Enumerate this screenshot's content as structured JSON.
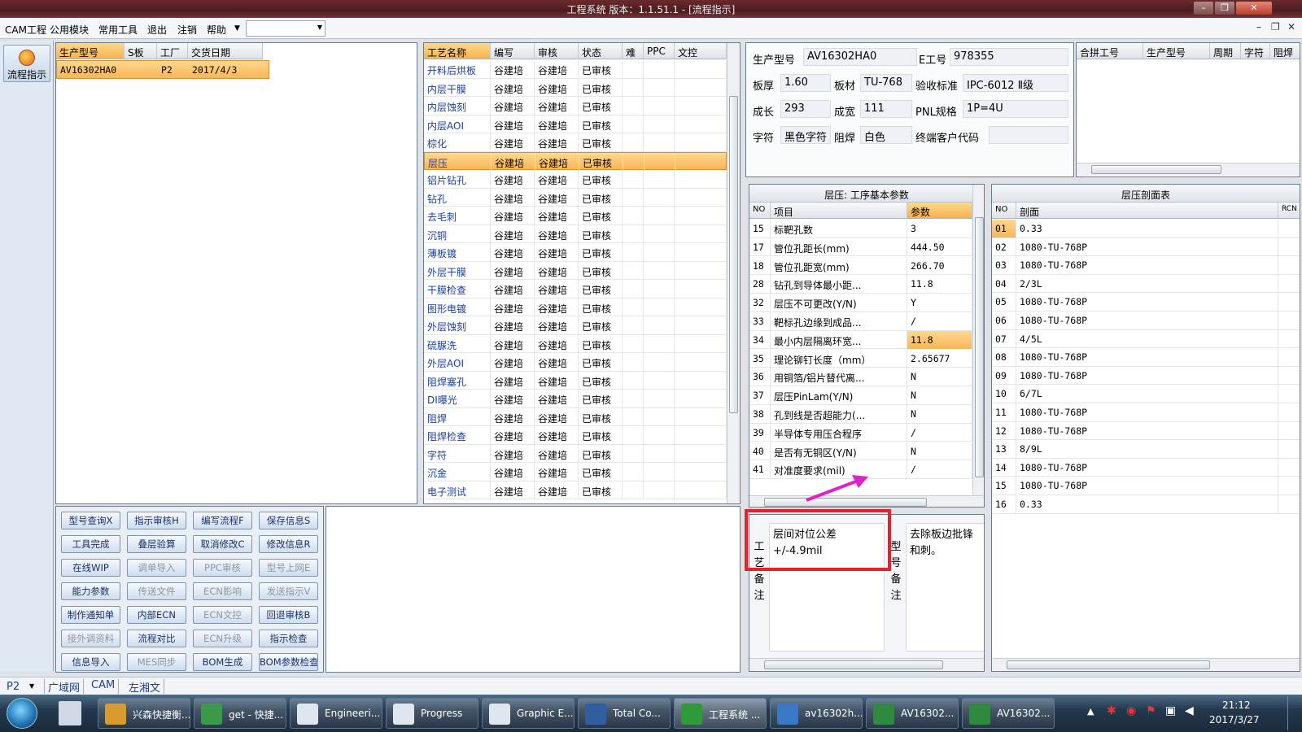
{
  "window": {
    "title": "工程系统  版本：1.1.51.1 - [流程指示]"
  },
  "menu": {
    "items": [
      "CAM工程",
      "公用模块",
      "常用工具",
      "退出",
      "注销",
      "帮助"
    ],
    "dropdown_value": ""
  },
  "left_toolbar": {
    "flow_button": "流程指示"
  },
  "order_grid": {
    "headers": [
      "生产型号",
      "S板",
      "工厂",
      "交货日期"
    ],
    "rows": [
      [
        "AV16302HA0",
        "",
        "P2",
        "2017/4/3"
      ]
    ]
  },
  "process_grid": {
    "headers": [
      "工艺名称",
      "编写",
      "审核",
      "状态",
      "难",
      "PPC",
      "文控"
    ],
    "rows": [
      [
        "开料后烘板",
        "谷建培",
        "谷建培",
        "已审核"
      ],
      [
        "内层干膜",
        "谷建培",
        "谷建培",
        "已审核"
      ],
      [
        "内层蚀刻",
        "谷建培",
        "谷建培",
        "已审核"
      ],
      [
        "内层AOI",
        "谷建培",
        "谷建培",
        "已审核"
      ],
      [
        "棕化",
        "谷建培",
        "谷建培",
        "已审核"
      ],
      [
        "层压",
        "谷建培",
        "谷建培",
        "已审核"
      ],
      [
        "铝片钻孔",
        "谷建培",
        "谷建培",
        "已审核"
      ],
      [
        "钻孔",
        "谷建培",
        "谷建培",
        "已审核"
      ],
      [
        "去毛刺",
        "谷建培",
        "谷建培",
        "已审核"
      ],
      [
        "沉铜",
        "谷建培",
        "谷建培",
        "已审核"
      ],
      [
        "薄板镀",
        "谷建培",
        "谷建培",
        "已审核"
      ],
      [
        "外层干膜",
        "谷建培",
        "谷建培",
        "已审核"
      ],
      [
        "干膜检查",
        "谷建培",
        "谷建培",
        "已审核"
      ],
      [
        "图形电镀",
        "谷建培",
        "谷建培",
        "已审核"
      ],
      [
        "外层蚀刻",
        "谷建培",
        "谷建培",
        "已审核"
      ],
      [
        "硫脲洗",
        "谷建培",
        "谷建培",
        "已审核"
      ],
      [
        "外层AOI",
        "谷建培",
        "谷建培",
        "已审核"
      ],
      [
        "阻焊塞孔",
        "谷建培",
        "谷建培",
        "已审核"
      ],
      [
        "DI曝光",
        "谷建培",
        "谷建培",
        "已审核"
      ],
      [
        "阻焊",
        "谷建培",
        "谷建培",
        "已审核"
      ],
      [
        "阻焊检查",
        "谷建培",
        "谷建培",
        "已审核"
      ],
      [
        "字符",
        "谷建培",
        "谷建培",
        "已审核"
      ],
      [
        "沉金",
        "谷建培",
        "谷建培",
        "已审核"
      ],
      [
        "电子测试",
        "谷建培",
        "谷建培",
        "已审核"
      ]
    ]
  },
  "buttons": [
    [
      "型号查询X",
      "指示审核H",
      "编写流程F",
      "保存信息S"
    ],
    [
      "工具完成",
      "叠层验算",
      "取消修改C",
      "修改信息R"
    ],
    [
      "在线WIP",
      "调单导入",
      "PPC审核",
      "型号上网E"
    ],
    [
      "能力参数",
      "传送文件",
      "ECN影响",
      "发送指示V"
    ],
    [
      "制作通知单",
      "内部ECN",
      "ECN文控",
      "回退审核B"
    ],
    [
      "接外调资料",
      "流程对比",
      "ECN升级",
      "指示检查"
    ],
    [
      "信息导入",
      "MES同步",
      "BOM生成",
      "BOM参数检查"
    ]
  ],
  "info": {
    "model_label": "生产型号",
    "model": "AV16302HA0",
    "e_label": "E工号",
    "e_no": "978355",
    "thick_label": "板厚",
    "thick": "1.60",
    "material_label": "板材",
    "material": "TU-768",
    "std_label": "验收标准",
    "std": "IPC-6012 Ⅱ级",
    "len_label": "成长",
    "len": "293",
    "width_label": "成宽",
    "width": "111",
    "pnl_label": "PNL规格",
    "pnl": "1P=4U",
    "char_label": "字符",
    "char": "黑色字符",
    "mask_label": "阻焊",
    "mask": "白色",
    "cust_label": "终端客户代码",
    "cust": ""
  },
  "merge_grid": {
    "headers": [
      "合拼工号",
      "生产型号",
      "周期",
      "字符",
      "阻焊"
    ]
  },
  "params": {
    "title": "层压: 工序基本参数",
    "headers": [
      "NO",
      "项目",
      "参数"
    ],
    "rows": [
      [
        "15",
        "标靶孔数",
        "3"
      ],
      [
        "17",
        "管位孔距长(mm)",
        "444.50"
      ],
      [
        "18",
        "管位孔距宽(mm)",
        "266.70"
      ],
      [
        "28",
        "钻孔到导体最小距...",
        "11.8"
      ],
      [
        "32",
        "层压不可更改(Y/N)",
        "Y"
      ],
      [
        "33",
        "靶标孔边缘到成品...",
        "/"
      ],
      [
        "34",
        "最小内层隔离环宽...",
        "11.8"
      ],
      [
        "35",
        "理论铆钉长度（mm）",
        "2.65677"
      ],
      [
        "36",
        "用铜箔/铝片替代离...",
        "N"
      ],
      [
        "37",
        "层压PinLam(Y/N)",
        "N"
      ],
      [
        "38",
        "孔到线是否超能力(...",
        "N"
      ],
      [
        "39",
        "半导体专用压合程序",
        "/"
      ],
      [
        "40",
        "是否有无铜区(Y/N)",
        "N"
      ],
      [
        "41",
        "对准度要求(mil)",
        "/"
      ]
    ]
  },
  "stack": {
    "title": "层压剖面表",
    "headers": [
      "NO",
      "剖面",
      "RCN"
    ],
    "rows": [
      [
        "01",
        "0.33"
      ],
      [
        "02",
        "1080-TU-768P"
      ],
      [
        "03",
        "1080-TU-768P"
      ],
      [
        "04",
        "2/3L"
      ],
      [
        "05",
        "1080-TU-768P"
      ],
      [
        "06",
        "1080-TU-768P"
      ],
      [
        "07",
        "4/5L"
      ],
      [
        "08",
        "1080-TU-768P"
      ],
      [
        "09",
        "1080-TU-768P"
      ],
      [
        "10",
        "6/7L"
      ],
      [
        "11",
        "1080-TU-768P"
      ],
      [
        "12",
        "1080-TU-768P"
      ],
      [
        "13",
        "8/9L"
      ],
      [
        "14",
        "1080-TU-768P"
      ],
      [
        "15",
        "1080-TU-768P"
      ],
      [
        "16",
        "0.33"
      ]
    ]
  },
  "notes": {
    "process_label": "工艺备注",
    "process_text": "层间对位公差+/-4.9mil",
    "model_label": "型号备注",
    "model_text": "去除板边批锋和刺。"
  },
  "statusbar": {
    "factory": "P2",
    "tabs": [
      "广域网",
      "CAM",
      "左湘文"
    ]
  },
  "taskbar": {
    "items": [
      "兴森快捷衡...",
      "get - 快捷...",
      "Engineeri...",
      "Progress",
      "Graphic E...",
      "Total Co...",
      "工程系统 ...",
      "av16302h...",
      "AV16302...",
      "AV16302..."
    ],
    "time": "21:12",
    "date": "2017/3/27"
  },
  "colors": {
    "highlight": "#f7b659",
    "annotation": "#e8202a",
    "arrow": "#e020c8"
  }
}
